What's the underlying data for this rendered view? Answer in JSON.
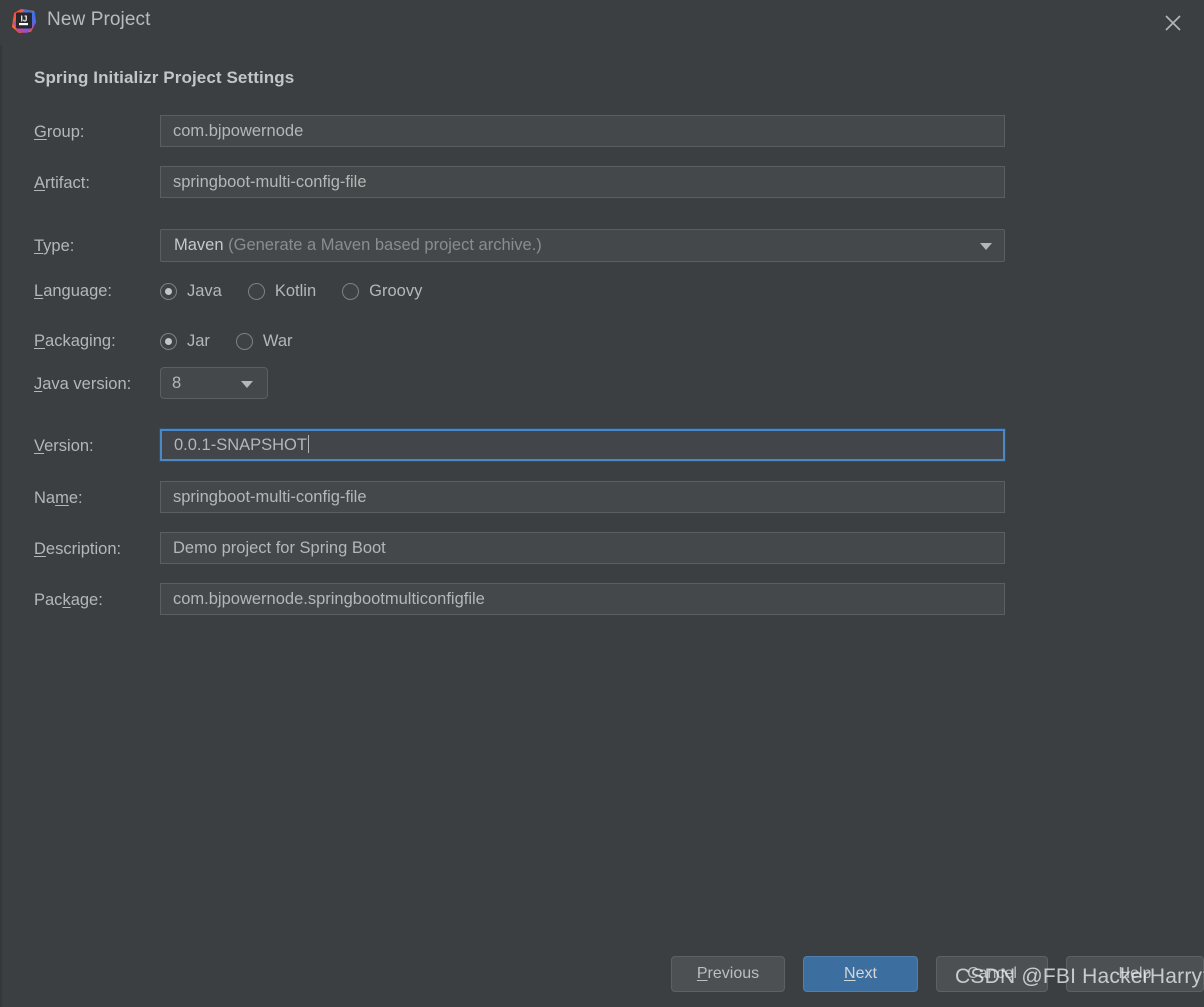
{
  "window": {
    "title": "New Project",
    "logo_icon": "intellij-idea-logo",
    "close_icon": "close-icon"
  },
  "section": {
    "title": "Spring Initializr Project Settings"
  },
  "form": {
    "group": {
      "label": "Group:",
      "mnemonic": "G",
      "value": "com.bjpowernode"
    },
    "artifact": {
      "label": "Artifact:",
      "mnemonic": "A",
      "value": "springboot-multi-config-file"
    },
    "type": {
      "label": "Type:",
      "mnemonic": "T",
      "value": "Maven",
      "hint": "(Generate a Maven based project archive.)",
      "icon": "chevron-down-icon"
    },
    "language": {
      "label": "Language:",
      "mnemonic": "L",
      "options": [
        "Java",
        "Kotlin",
        "Groovy"
      ],
      "selected": "Java"
    },
    "packaging": {
      "label": "Packaging:",
      "mnemonic": "P",
      "options": [
        "Jar",
        "War"
      ],
      "selected": "Jar"
    },
    "java_version": {
      "label": "Java version:",
      "mnemonic": "J",
      "value": "8",
      "icon": "chevron-down-icon"
    },
    "version": {
      "label": "Version:",
      "mnemonic": "V",
      "value": "0.0.1-SNAPSHOT",
      "focused": true
    },
    "name": {
      "label": "Name:",
      "mnemonic": "m",
      "value": "springboot-multi-config-file"
    },
    "description": {
      "label": "Description:",
      "mnemonic": "D",
      "value": "Demo project for Spring Boot"
    },
    "package": {
      "label": "Package:",
      "mnemonic": "k",
      "value": "com.bjpowernode.springbootmulticonfigfile"
    }
  },
  "footer": {
    "previous": "Previous",
    "next": "Next",
    "cancel": "Cancel",
    "help": "Help"
  },
  "watermark": {
    "text": "CSDN @FBI HackerHarry浩"
  },
  "colors": {
    "background": "#3c3f41",
    "field_background": "#45484a",
    "field_border": "#5c5f61",
    "text": "#b4b6b8",
    "focus_blue": "#4a88c7",
    "primary_button": "#3c6e9f"
  }
}
